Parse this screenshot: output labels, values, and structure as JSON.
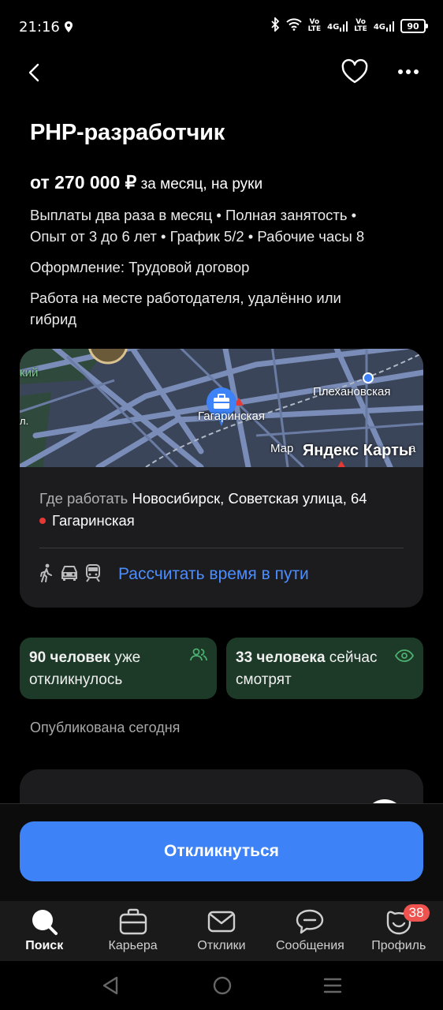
{
  "status": {
    "time": "21:16",
    "volte1": "Vo\nLTE",
    "sig1": "4G",
    "volte2": "Vo\nLTE",
    "sig2": "4G",
    "battery": "90"
  },
  "vacancy": {
    "title": "PHP-разработчик",
    "salary_main": "от 270 000 ₽",
    "salary_suffix": " за месяц, на руки",
    "info_line1": "Выплаты два раза в месяц • Полная занятость •",
    "info_line2": "Опыт от 3 до 6 лет • График 5/2 • Рабочие часы 8",
    "employment": "Оформление: Трудовой договор",
    "work_format_line1": "Работа на месте работодателя, удалённо или",
    "work_format_line2": "гибрид"
  },
  "map": {
    "label_left": "кий",
    "label_plekhanovskaya": "Плехановская",
    "label_gagarinskaya": "Гагаринская",
    "label_mar": "Мар",
    "label_partial": "а",
    "label_l": "л.",
    "brand": "Яндекс Карты",
    "address_prefix": "Где работать",
    "address": " Новосибирск, Советская улица, 64",
    "metro": "Гагаринская",
    "route_link": "Рассчитать время в пути",
    "colors": {
      "metro": "#e53935",
      "link": "#4c8dff",
      "pin": "#3d83f7"
    }
  },
  "stats": {
    "responded_bold": "90 человек",
    "responded_rest": " уже",
    "responded_line2": "откликнулось",
    "watching_bold": "33 человека",
    "watching_rest": " сейчас",
    "watching_line2": "смотрят"
  },
  "published": "Опубликована сегодня",
  "apply_button": "Откликнуться",
  "tabs": [
    {
      "label": "Поиск",
      "icon": "search-icon"
    },
    {
      "label": "Карьера",
      "icon": "briefcase-icon"
    },
    {
      "label": "Отклики",
      "icon": "envelope-icon"
    },
    {
      "label": "Сообщения",
      "icon": "chat-icon"
    },
    {
      "label": "Профиль",
      "icon": "profile-icon",
      "badge": "38"
    }
  ]
}
